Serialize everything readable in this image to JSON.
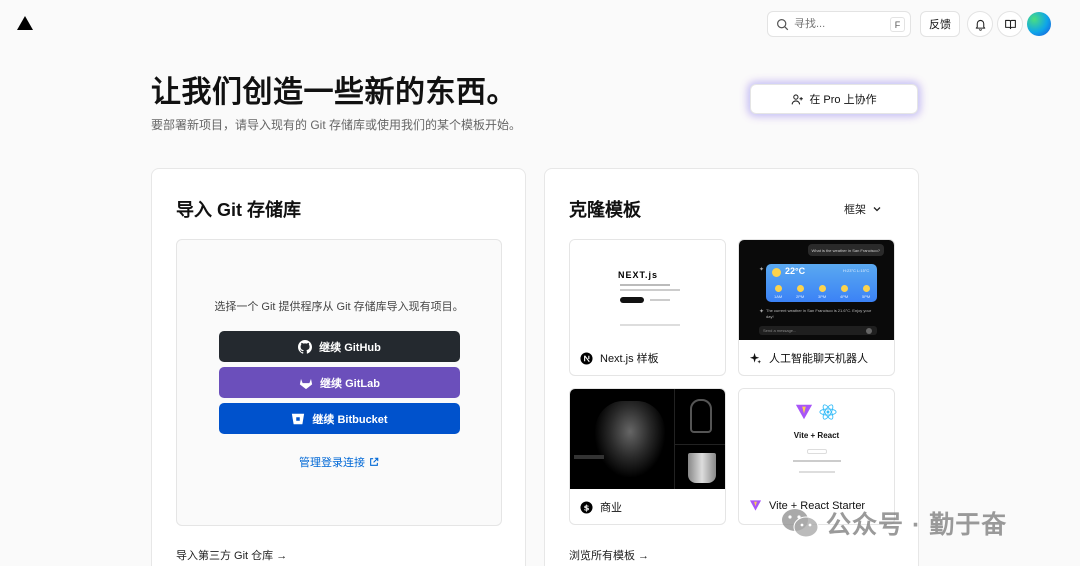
{
  "nav": {
    "search_placeholder": "寻找...",
    "search_shortcut": "F",
    "feedback_label": "反馈"
  },
  "header": {
    "title": "让我们创造一些新的东西。",
    "subtitle": "要部署新项目，请导入现有的 Git 存储库或使用我们的某个模板开始。",
    "pro_button_label": "在 Pro 上协作"
  },
  "import_card": {
    "title": "导入 Git 存储库",
    "prompt": "选择一个 Git 提供程序从 Git 存储库导入现有项目。",
    "buttons": [
      {
        "label": "继续 GitHub",
        "icon": "github-icon",
        "color": "#24292f"
      },
      {
        "label": "继续 GitLab",
        "icon": "gitlab-icon",
        "color": "#6b4fbb"
      },
      {
        "label": "继续 Bitbucket",
        "icon": "bitbucket-icon",
        "color": "#0052cc"
      }
    ],
    "manage_link": "管理登录连接",
    "third_party_link": "导入第三方 Git 仓库 →"
  },
  "clone_card": {
    "title": "克隆模板",
    "framework_select": "框架",
    "templates": [
      {
        "label": "Next.js 样板",
        "icon": "nextjs-icon"
      },
      {
        "label": "人工智能聊天机器人",
        "icon": "sparkle-icon"
      },
      {
        "label": "商业",
        "icon": "commerce-icon"
      },
      {
        "label": "Vite + React Starter",
        "icon": "vite-icon"
      }
    ],
    "browse_link": "浏览所有模板 →"
  },
  "thumbs": {
    "next_logo": "NEXT.js",
    "ai_question": "What is the weather in San Francisco?",
    "ai_temp": "22°C",
    "ai_hilo": "H:23°C L:15°C",
    "ai_times": [
      "1AM",
      "2PM",
      "3PM",
      "4PM",
      "5PM"
    ],
    "ai_answer": "The current weather in San Francisco is 21.6°C. Enjoy your day!",
    "ai_input": "Send a message...",
    "vite_title": "Vite + React"
  },
  "watermark": "公众号 · 勤于奋",
  "colors": {
    "link": "#0068d6",
    "github": "#24292f",
    "gitlab": "#6b4fbb",
    "bitbucket": "#0052cc"
  }
}
